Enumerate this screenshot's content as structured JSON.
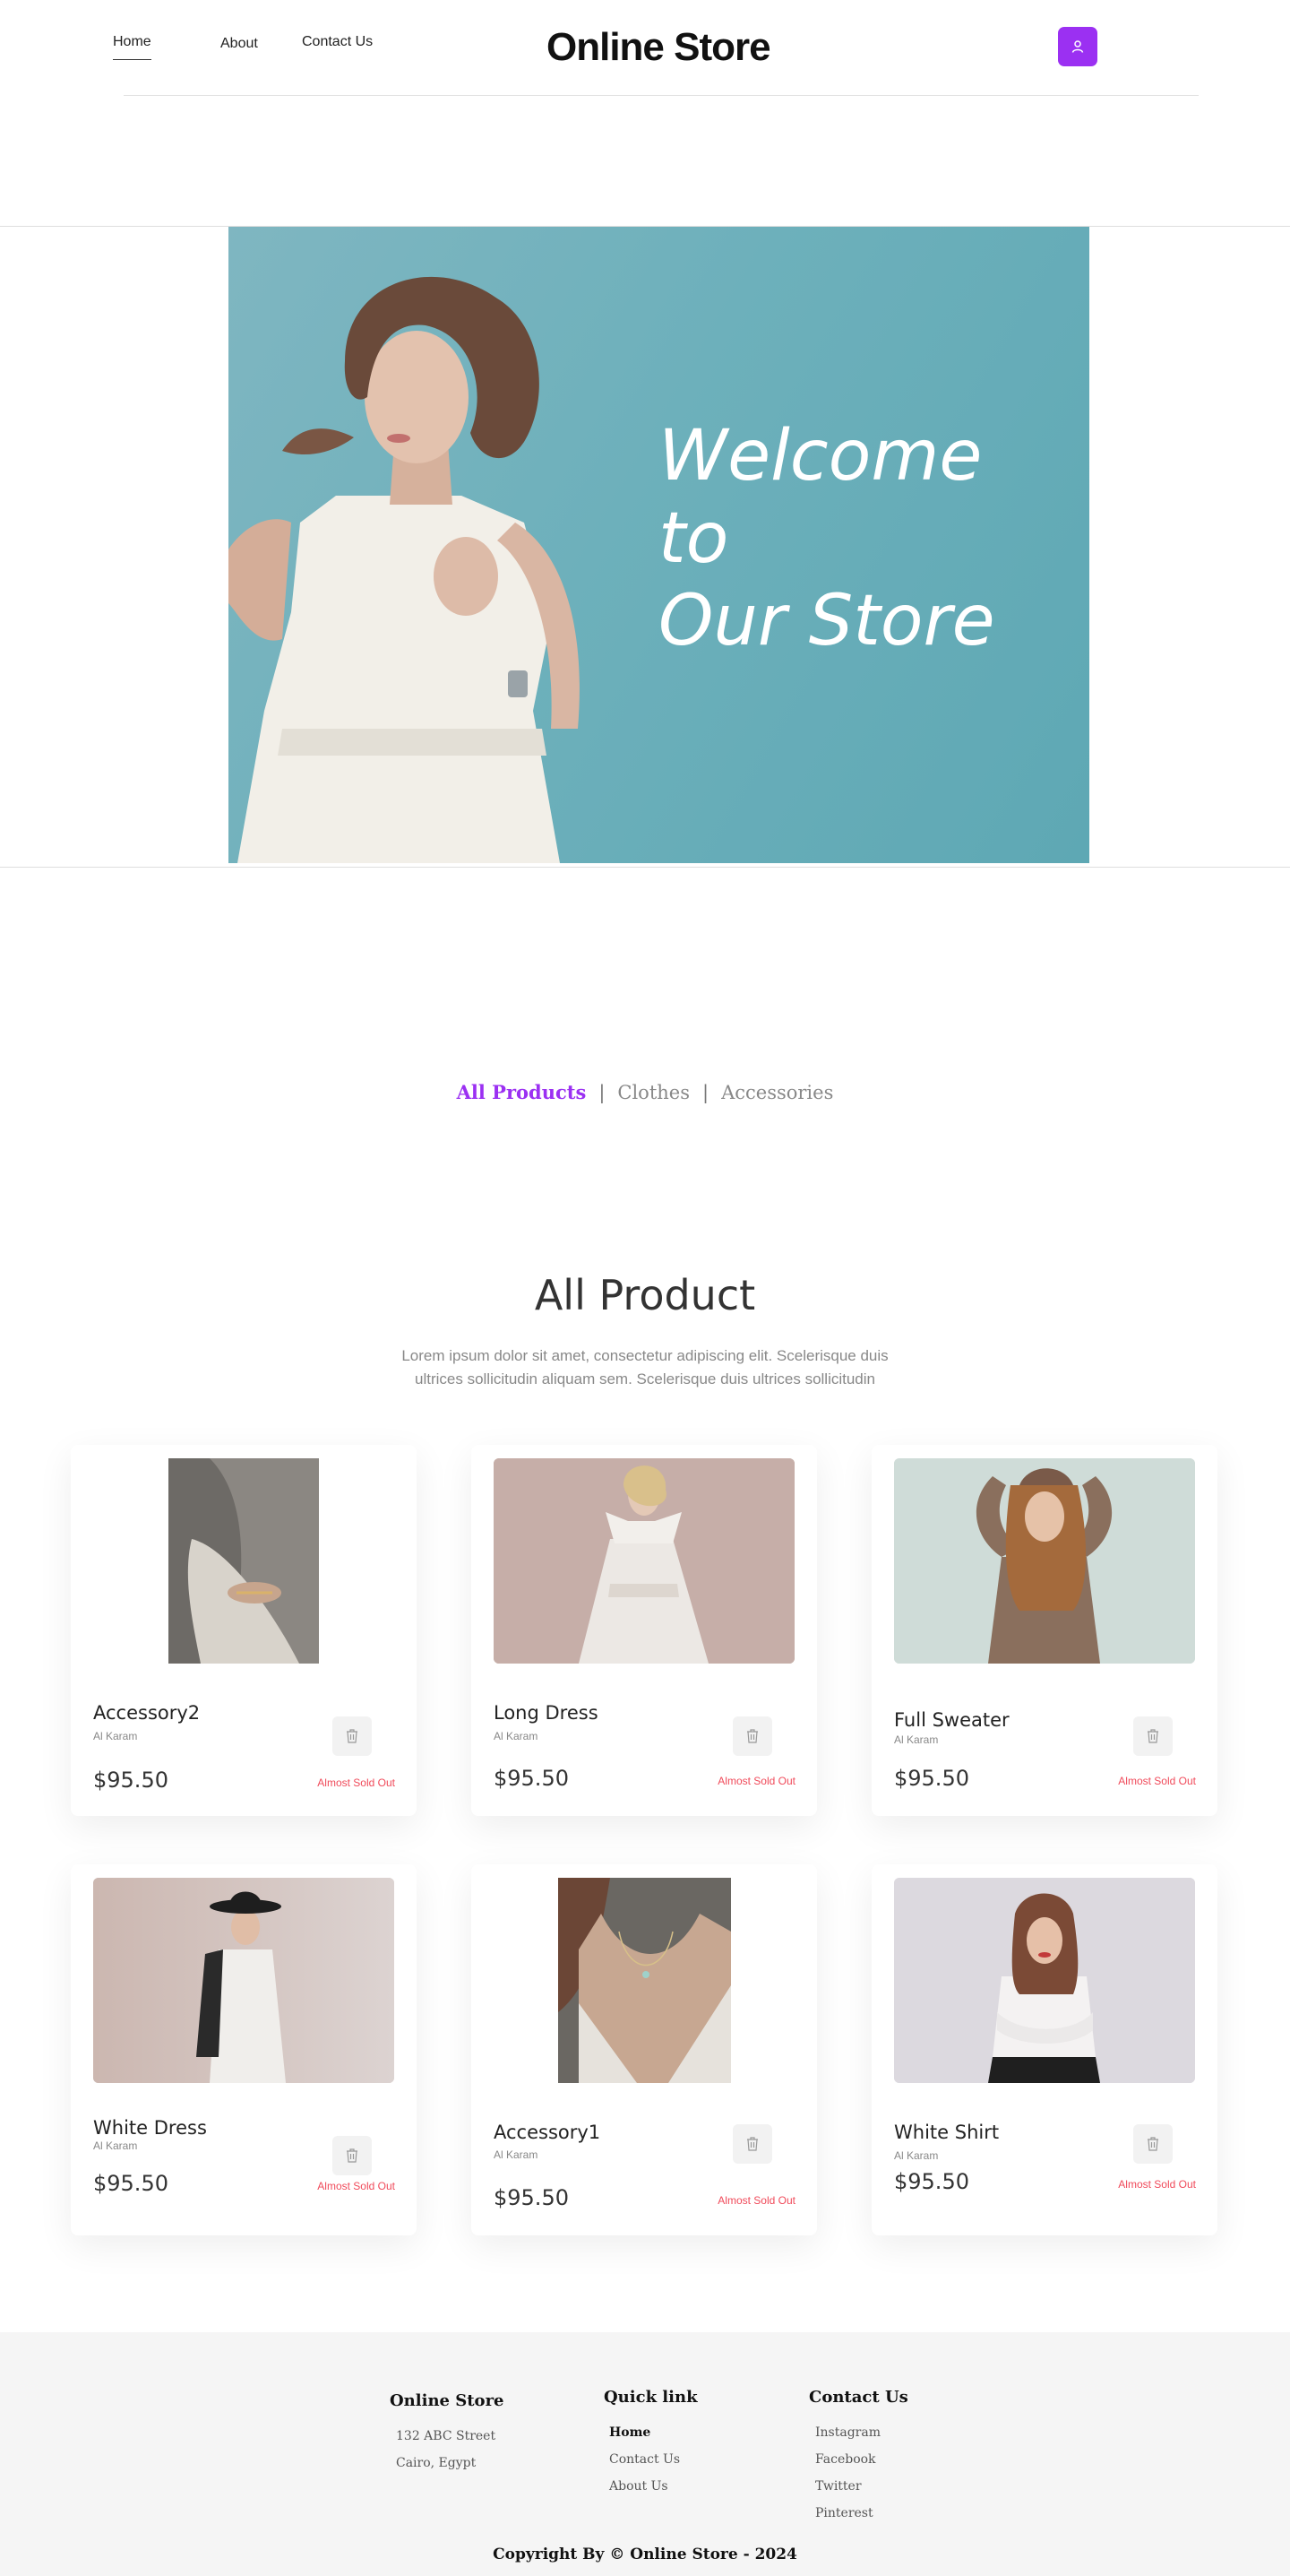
{
  "nav": {
    "links": [
      "Home",
      "About",
      "Contact Us"
    ],
    "brand": "Online Store",
    "user_icon": "user-icon",
    "accent": "#9b30f2"
  },
  "hero": {
    "title_lines": [
      "Welcome",
      "to",
      "Our Store"
    ],
    "background": "#6db0bb"
  },
  "filters": {
    "items": [
      "All Products",
      "Clothes",
      "Accessories"
    ],
    "active": "All Products",
    "separator": "|"
  },
  "section": {
    "title": "All Product",
    "description": "Lorem ipsum dolor sit amet, consectetur adipiscing elit. Scelerisque duis ultrices sollicitudin aliquam sem. Scelerisque duis ultrices sollicitudin"
  },
  "products": [
    {
      "name": "Accessory2",
      "maker": "Al Karam",
      "price": "$95.50",
      "stock": "Almost Sold Out",
      "icon": "trash-icon"
    },
    {
      "name": "Long Dress",
      "maker": "Al Karam",
      "price": "$95.50",
      "stock": "Almost Sold Out",
      "icon": "trash-icon"
    },
    {
      "name": "Full Sweater",
      "maker": "Al Karam",
      "price": "$95.50",
      "stock": "Almost Sold Out",
      "icon": "trash-icon"
    },
    {
      "name": "White Dress",
      "maker": "Al Karam",
      "price": "$95.50",
      "stock": "Almost Sold Out",
      "icon": "trash-icon"
    },
    {
      "name": "Accessory1",
      "maker": "Al Karam",
      "price": "$95.50",
      "stock": "Almost Sold Out",
      "icon": "trash-icon"
    },
    {
      "name": "White Shirt",
      "maker": "Al Karam",
      "price": "$95.50",
      "stock": "Almost Sold Out",
      "icon": "trash-icon"
    }
  ],
  "footer": {
    "store": {
      "title": "Online Store",
      "lines": [
        "132 ABC Street",
        "Cairo, Egypt"
      ]
    },
    "quick": {
      "title": "Quick link",
      "links": [
        "Home",
        "Contact Us",
        "About Us"
      ]
    },
    "contact": {
      "title": "Contact Us",
      "links": [
        "Instagram",
        "Facebook",
        "Twitter",
        "Pinterest"
      ]
    },
    "copyright": "Copyright By © Online Store - 2024"
  }
}
